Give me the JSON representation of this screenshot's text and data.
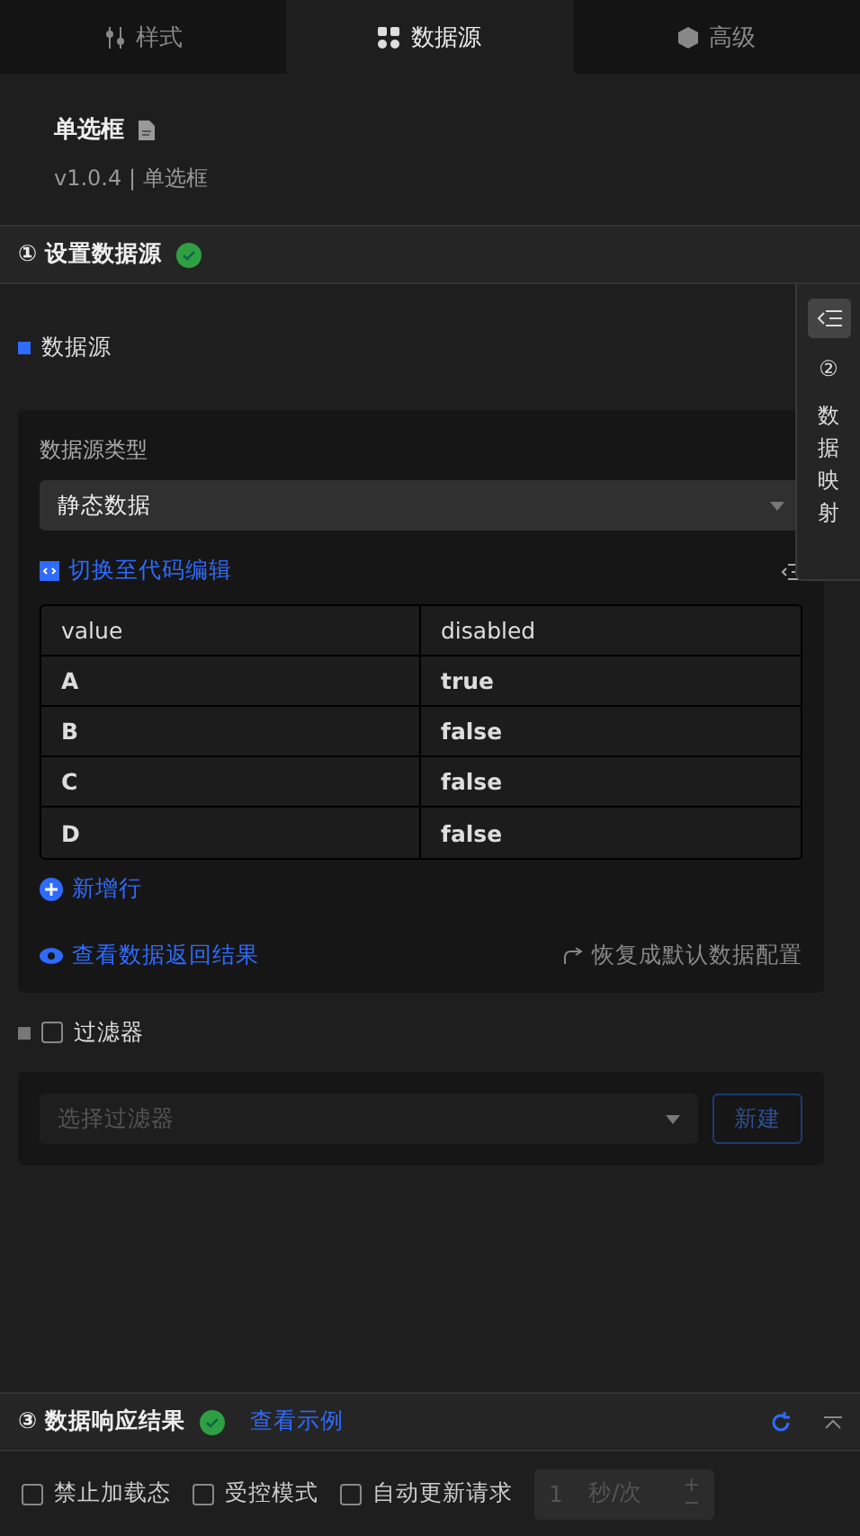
{
  "tabs": [
    {
      "label": "样式",
      "selected": false
    },
    {
      "label": "数据源",
      "selected": true
    },
    {
      "label": "高级",
      "selected": false
    }
  ],
  "component": {
    "name": "单选框",
    "version": "v1.0.4 | 单选框"
  },
  "section_1": {
    "title": "① 设置数据源",
    "done": true
  },
  "side_tab": {
    "number": "②",
    "label": "数据映射"
  },
  "data_source": {
    "heading": "数据源",
    "type_label": "数据源类型",
    "type_value": "静态数据",
    "code_link": "切换至代码编辑",
    "table": {
      "columns": [
        "value",
        "disabled"
      ],
      "rows": [
        [
          "A",
          "true"
        ],
        [
          "B",
          "false"
        ],
        [
          "C",
          "false"
        ],
        [
          "D",
          "false"
        ]
      ]
    },
    "add_row": "新增行",
    "view_result": "查看数据返回结果",
    "restore": "恢复成默认数据配置"
  },
  "filter": {
    "label": "过滤器",
    "checked": false,
    "placeholder": "选择过滤器",
    "new_button": "新建"
  },
  "section_3": {
    "title": "③ 数据响应结果",
    "done": true,
    "example_link": "查看示例"
  },
  "options": [
    {
      "label": "禁止加载态",
      "checked": false
    },
    {
      "label": "受控模式",
      "checked": false
    },
    {
      "label": "自动更新请求",
      "checked": false
    }
  ],
  "interval": {
    "value": "1",
    "unit": "秒/次",
    "plus": "+",
    "minus": "−"
  }
}
